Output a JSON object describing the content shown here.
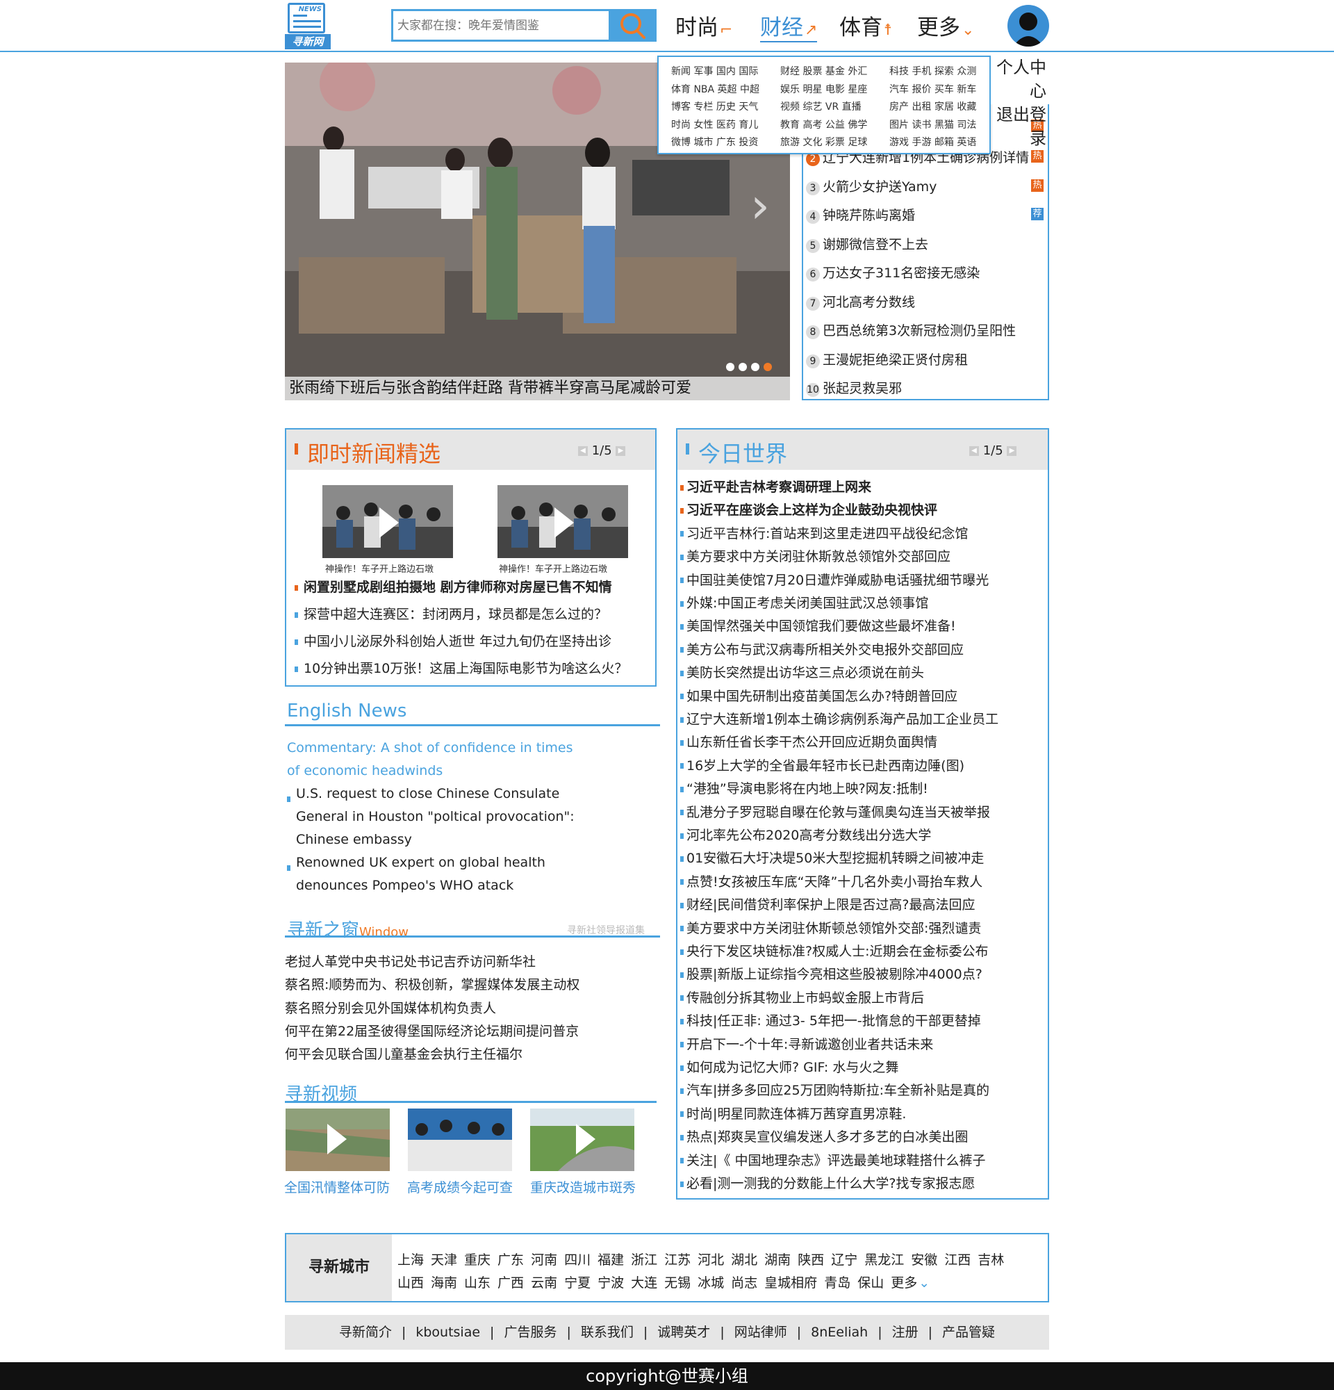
{
  "header": {
    "logo_badge": "NEWS",
    "logo_text": "寻新网",
    "search_placeholder": "大家都在搜：晚年爱情图鉴",
    "nav": [
      "时尚",
      "财经",
      "体育",
      "更多"
    ],
    "active_nav": "财经"
  },
  "dropdown": {
    "rows": [
      [
        "新闻 军事 国内 国际",
        "财经 股票 基金 外汇",
        "科技 手机 探索 众测"
      ],
      [
        "体育 NBA 英超 中超",
        "娱乐 明星 电影 星座",
        "汽车 报价 买车 新车"
      ],
      [
        "博客 专栏 历史 天气",
        "视频 综艺 VR 直播",
        "房产 出租 家居 收藏"
      ],
      [
        "时尚 女性 医药 育儿",
        "教育 高考 公益 佛学",
        "图片 读书 黑猫 司法"
      ],
      [
        "微博 城市 广东 投资",
        "旅游 文化 彩票 足球",
        "游戏 手游 邮箱 英语"
      ]
    ]
  },
  "usermenu": {
    "center": "个人中心",
    "logout": "退出登录"
  },
  "hero": {
    "caption": "张雨绮下班后与张含韵结伴赶路 背带裤半穿高马尾减龄可爱"
  },
  "hotlist": {
    "items": [
      {
        "num": "2",
        "text": "辽宁大连新增1例本土确诊病例详情",
        "tag": "热"
      },
      {
        "num": "3",
        "text": "火箭少女护送Yamy",
        "tag": "热"
      },
      {
        "num": "4",
        "text": "钟晓芹陈屿离婚",
        "tag": "荐"
      },
      {
        "num": "5",
        "text": "谢娜微信登不上去",
        "tag": ""
      },
      {
        "num": "6",
        "text": "万达女子311名密接无感染",
        "tag": ""
      },
      {
        "num": "7",
        "text": "河北高考分数线",
        "tag": ""
      },
      {
        "num": "8",
        "text": "巴西总统第3次新冠检测仍呈阳性",
        "tag": ""
      },
      {
        "num": "9",
        "text": "王漫妮拒绝梁正贤付房租",
        "tag": ""
      },
      {
        "num": "10",
        "text": "张起灵救吴邪",
        "tag": ""
      }
    ],
    "top_tag": "热",
    "colors": {
      "hot": "#e8641b",
      "rec": "#3b8fd4"
    }
  },
  "instant": {
    "title": "即时新闻精选",
    "pager": "1/5",
    "video_captions": [
      "神操作！车子开上路边石墩",
      "神操作！车子开上路边石墩"
    ],
    "lines": [
      {
        "text": "闲置别墅成剧组拍摄地 剧方律师称对房屋已售不知情",
        "bold": true
      },
      {
        "text": "探营中超大连赛区：封闭两月，球员都是怎么过的？",
        "bold": false
      },
      {
        "text": "中国小儿泌尿外科创始人逝世 年过九旬仍在坚持出诊",
        "bold": false
      },
      {
        "text": "10分钟出票10万张！这届上海国际电影节为啥这么火？",
        "bold": false
      }
    ]
  },
  "english": {
    "title": "English News",
    "headline_1": "Commentary: A shot of confidence in times",
    "headline_2": "of economic headwinds",
    "item1_l1": "U.S. request to close Chinese Consulate",
    "item1_l2": "General in Houston \"poltical provocation\":",
    "item1_l3": "Chinese embassy",
    "item2_l1": "Renowned UK expert on global health",
    "item2_l2": "denounces Pompeo's WHO atack"
  },
  "window": {
    "title": "寻新之窗",
    "title_en": "Window",
    "subtitle": "寻新社领导报道集",
    "lines": [
      "老挝人革党中央书记处书记吉乔访问新华社",
      "蔡名照:顺势而为、积极创新，掌握媒体发展主动权",
      "蔡名照分别会见外国媒体机构负责人",
      "何平在第22届圣彼得堡国际经济论坛期间提问普京",
      "何平会见联合国儿童基金会执行主任福尔"
    ]
  },
  "videos": {
    "title": "寻新视频",
    "items": [
      "全国汛情整体可防",
      "高考成绩今起可查",
      "重庆改造城市斑秀"
    ]
  },
  "world": {
    "title": "今日世界",
    "pager": "1/5",
    "lines": [
      {
        "text": "习近平赴吉林考察调研理上网来",
        "bold": true
      },
      {
        "text": "习近平在座谈会上这样为企业鼓劲央视快评",
        "bold": true
      },
      {
        "text": "习近平吉林行:首站来到这里走进四平战役纪念馆",
        "bold": false
      },
      {
        "text": "美方要求中方关闭驻休斯敦总领馆外交部回应",
        "bold": false
      },
      {
        "text": "中国驻美使馆7月20日遭炸弹威胁电话骚扰细节曝光",
        "bold": false
      },
      {
        "text": "外媒:中国正考虑关闭美国驻武汉总领事馆",
        "bold": false
      },
      {
        "text": "美国悍然强关中国领馆我们要做这些最坏准备!",
        "bold": false
      },
      {
        "text": "美方公布与武汉病毒所相关外交电报外交部回应",
        "bold": false
      },
      {
        "text": "美防长突然提出访华这三点必须说在前头",
        "bold": false
      },
      {
        "text": "如果中国先研制出疫苗美国怎么办?特朗普回应",
        "bold": false
      },
      {
        "text": "辽宁大连新增1例本土确诊病例系海产品加工企业员工",
        "bold": false
      },
      {
        "text": "山东新任省长李干杰公开回应近期负面舆情",
        "bold": false
      },
      {
        "text": "16岁上大学的全省最年轻市长已赴西南边陲(图)",
        "bold": false
      },
      {
        "text": "“港独”导演电影将在内地上映?网友:抵制!",
        "bold": false
      },
      {
        "text": "乱港分子罗冠聪自曝在伦敦与蓬佩奥勾连当天被举报",
        "bold": false
      },
      {
        "text": "河北率先公布2020高考分数线出分选大学",
        "bold": false
      },
      {
        "text": "01安徽石大圩决堤50米大型挖掘机转瞬之间被冲走",
        "bold": false
      },
      {
        "text": "点赞!女孩被压车底“天降”十几名外卖小哥抬车救人",
        "bold": false
      },
      {
        "text": "财经|民间借贷利率保护上限是否过高?最高法回应",
        "bold": false
      },
      {
        "text": "美方要求中方关闭驻休斯顿总领馆外交部:强烈谴责",
        "bold": false
      },
      {
        "text": "央行下发区块链标准?权威人士:近期会在金标委公布",
        "bold": false
      },
      {
        "text": "股票|新版上证综指今亮相这些股被剔除冲4000点?",
        "bold": false
      },
      {
        "text": "传融创分拆其物业上市蚂蚁金服上市背后",
        "bold": false
      },
      {
        "text": "科技|任正非: 通过3- 5年把一-批惰怠的干部更替掉",
        "bold": false
      },
      {
        "text": "开启下一-个十年:寻新诚邀创业者共话未来",
        "bold": false
      },
      {
        "text": "如何成为记忆大师? GIF: 水与火之舞",
        "bold": false
      },
      {
        "text": "汽车|拼多多回应25万团购特斯拉:车全新补贴是真的",
        "bold": false
      },
      {
        "text": "时尚|明星同款连体裤万茜穿直男凉鞋.",
        "bold": false
      },
      {
        "text": "热点|郑爽吴宣仪编发迷人多才多艺的白冰美出圈",
        "bold": false
      },
      {
        "text": "关注|《 中国地理杂志》评选最美地球鞋搭什么裤子",
        "bold": false
      },
      {
        "text": "必看|测一测我的分数能上什么大学?找专家报志愿",
        "bold": false
      }
    ]
  },
  "cities": {
    "label": "寻新城市",
    "row1": [
      "上海",
      "天津",
      "重庆",
      "广东",
      "河南",
      "四川",
      "福建",
      "浙江",
      "江苏",
      "河北",
      "湖北",
      "湖南",
      "陕西",
      "辽宁",
      "黑龙江",
      "安徽",
      "江西",
      "吉林"
    ],
    "row2": [
      "山西",
      "海南",
      "山东",
      "广西",
      "云南",
      "宁夏",
      "宁波",
      "大连",
      "无锡",
      "冰城",
      "尚志",
      "皇城相府",
      "青岛",
      "保山"
    ],
    "more": "更多"
  },
  "footer": {
    "links": [
      "寻新简介",
      "kboutsiae",
      "广告服务",
      "联系我们",
      "诚聘英才",
      "网站律师",
      "8nEeliah",
      "注册",
      "产品管疑"
    ],
    "copyright": "copyright@世赛小组"
  },
  "colors": {
    "accent": "#4aa3df",
    "orange": "#e8641b"
  }
}
